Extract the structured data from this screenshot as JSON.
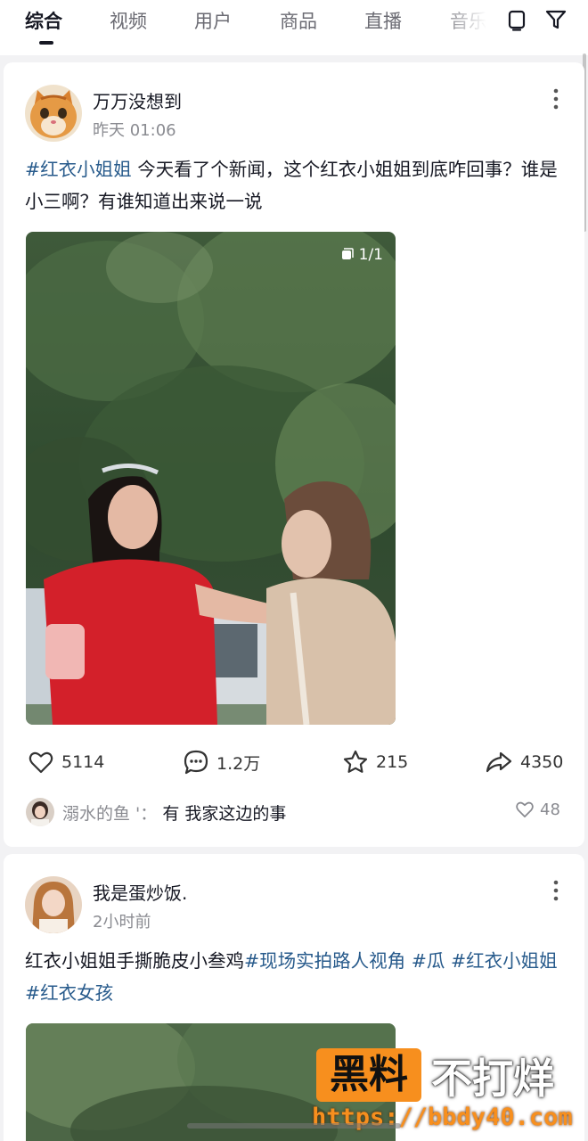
{
  "tabs": [
    {
      "label": "综合",
      "active": true
    },
    {
      "label": "视频",
      "active": false
    },
    {
      "label": "用户",
      "active": false
    },
    {
      "label": "商品",
      "active": false
    },
    {
      "label": "直播",
      "active": false
    },
    {
      "label": "音乐",
      "active": false
    }
  ],
  "top_icons": [
    "tablet-icon",
    "filter-icon"
  ],
  "posts": [
    {
      "username": "万万没想到",
      "timestamp": "昨天 01:06",
      "text_segments": [
        {
          "text": "#红衣小姐姐",
          "hashtag": true
        },
        {
          "text": " 今天看了个新闻，这个红衣小姐姐到底咋回事？谁是小三啊？有谁知道出来说一说",
          "hashtag": false
        }
      ],
      "media_counter": "1/1",
      "likes": "5114",
      "comments": "1.2万",
      "favorites": "215",
      "shares": "4350",
      "top_comment": {
        "user": "溺水的鱼 '：",
        "text": "有 我家这边的事",
        "likes": "48"
      }
    },
    {
      "username": "我是蛋炒饭.",
      "timestamp": "2小时前",
      "text_segments": [
        {
          "text": "红衣小姐姐手撕脆皮小叁鸡",
          "hashtag": false
        },
        {
          "text": "#现场实拍路人视角",
          "hashtag": true
        },
        {
          "text": " ",
          "hashtag": false
        },
        {
          "text": "#瓜",
          "hashtag": true
        },
        {
          "text": " ",
          "hashtag": false
        },
        {
          "text": "#红衣小姐姐",
          "hashtag": true
        },
        {
          "text": " ",
          "hashtag": false
        },
        {
          "text": "#红衣女孩",
          "hashtag": true
        }
      ]
    }
  ],
  "watermark": {
    "box_text": "黑料",
    "rest_text": "不打烊",
    "url": "https://bbdy40.com"
  },
  "colors": {
    "hashtag": "#285b8c",
    "background": "#f2f2f4",
    "watermark_orange": "#f78f1e"
  }
}
